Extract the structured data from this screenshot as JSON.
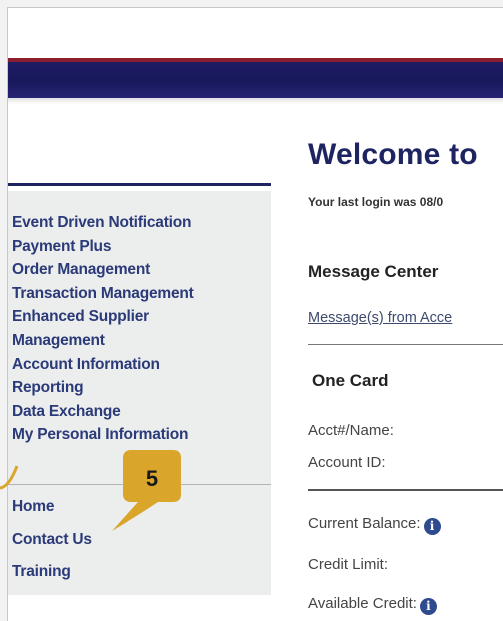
{
  "sidebar": {
    "menu_items": [
      "Event Driven Notification",
      "Payment Plus",
      "Order Management",
      "Transaction Management",
      "Enhanced Supplier",
      "Management",
      "Account Information",
      "Reporting",
      "Data Exchange",
      "My Personal Information"
    ],
    "bottom_links": [
      "Home",
      "Contact Us",
      "Training"
    ]
  },
  "main": {
    "title": "Welcome to",
    "last_login": "Your last login was 08/0",
    "message_center": {
      "heading": "Message Center",
      "link": "Message(s) from Acce"
    },
    "one_card": {
      "heading": "One Card",
      "acct_label": "Acct#/Name:",
      "account_id_label": "Account ID:",
      "current_balance_label": "Current Balance:",
      "credit_limit_label": "Credit Limit:",
      "available_credit_label": "Available Credit:"
    }
  },
  "callout": {
    "number": "5",
    "color": "#d9a52a"
  },
  "colors": {
    "banner": "#1e1c63",
    "banner_stripe": "#8c1d2f",
    "nav_text": "#2b3a78",
    "title": "#1e2461",
    "info_icon": "#2e4b8f"
  }
}
